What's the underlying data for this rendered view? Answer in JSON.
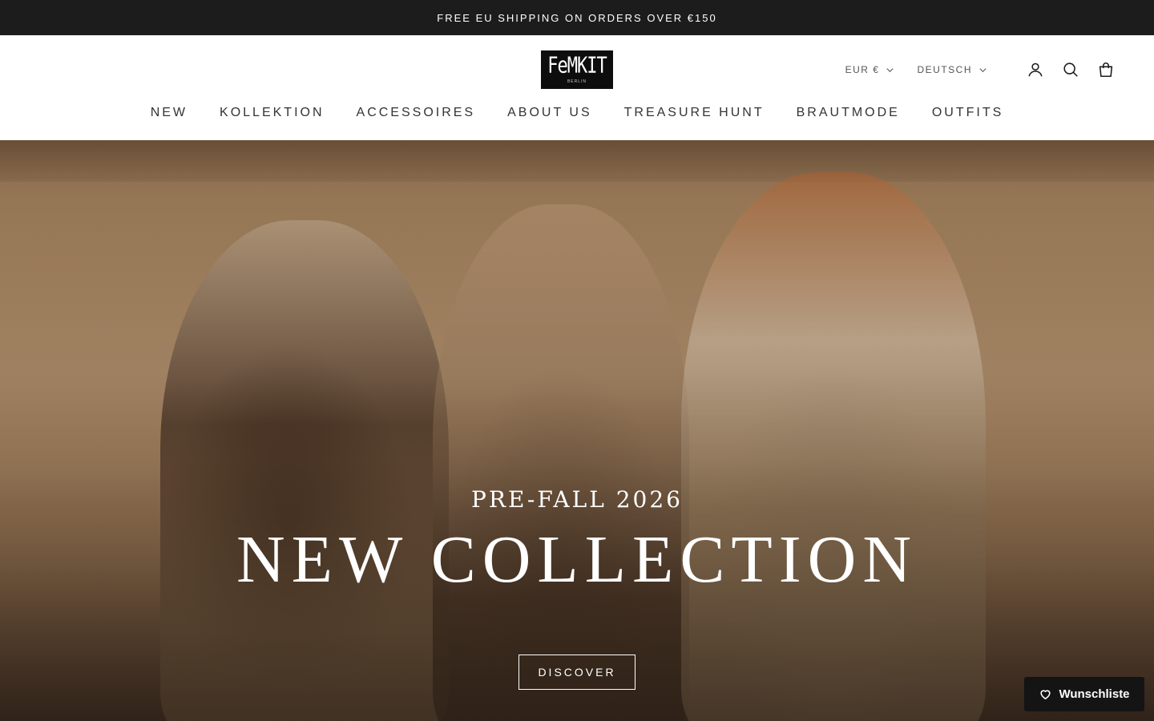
{
  "announcement": {
    "text": "FREE EU SHIPPING ON ORDERS OVER €150"
  },
  "header": {
    "logo": {
      "word": "FeMKIT",
      "sub": "BERLIN"
    },
    "currency": "EUR €",
    "language": "DEUTSCH",
    "icons": [
      "account-icon",
      "search-icon",
      "cart-icon"
    ]
  },
  "nav": {
    "items": [
      {
        "label": "NEW"
      },
      {
        "label": "KOLLEKTION"
      },
      {
        "label": "ACCESSOIRES"
      },
      {
        "label": "ABOUT US"
      },
      {
        "label": "TREASURE HUNT"
      },
      {
        "label": "BRAUTMODE"
      },
      {
        "label": "OUTFITS"
      }
    ]
  },
  "hero": {
    "subtitle": "PRE-FALL 2026",
    "title": "NEW COLLECTION",
    "button": "DISCOVER"
  },
  "wishlist": {
    "label": "Wunschliste"
  }
}
